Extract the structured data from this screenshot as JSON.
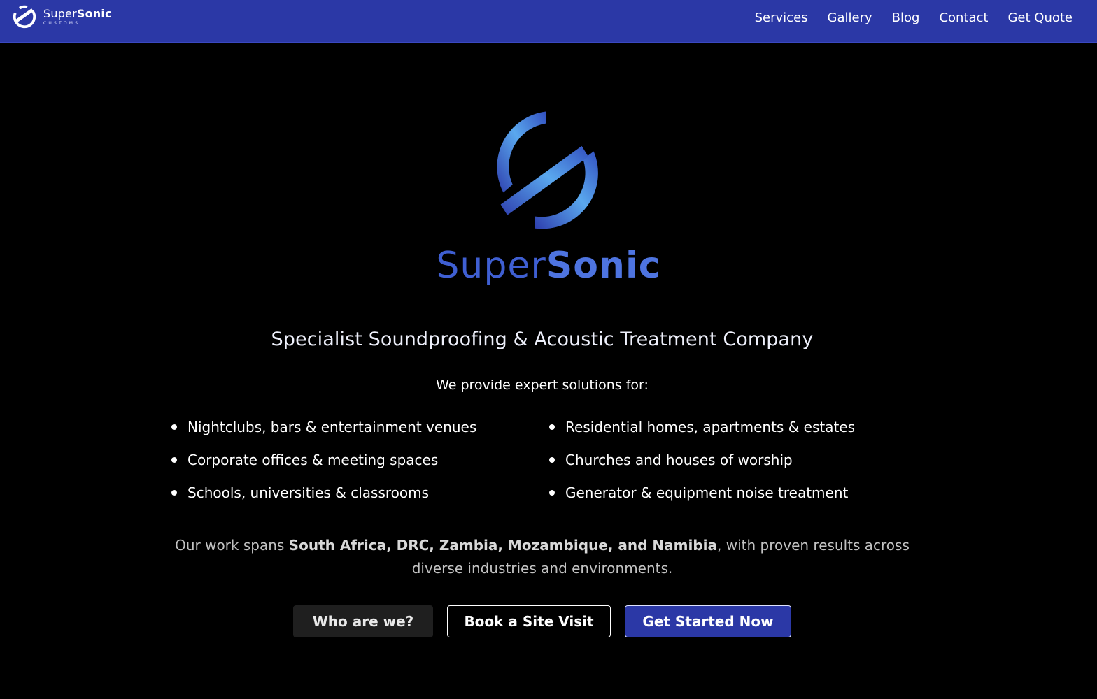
{
  "brand": {
    "name_light": "Super",
    "name_bold": "Sonic",
    "tagline": "CUSTOMS",
    "logo_icon": "supersonic-s-logo-icon"
  },
  "nav": {
    "items": [
      {
        "label": "Services"
      },
      {
        "label": "Gallery"
      },
      {
        "label": "Blog"
      },
      {
        "label": "Contact"
      },
      {
        "label": "Get Quote"
      }
    ]
  },
  "hero": {
    "logo_icon": "supersonic-s-logo-icon",
    "wordmark_light": "Super",
    "wordmark_bold": "Sonic",
    "tagline": "Specialist Soundproofing & Acoustic Treatment Company",
    "intro": "We provide expert solutions for:",
    "services": [
      "Nightclubs, bars & entertainment venues",
      "Residential homes, apartments & estates",
      "Corporate offices & meeting spaces",
      "Churches and houses of worship",
      "Schools, universities & classrooms",
      "Generator & equipment noise treatment"
    ],
    "reach_prefix": "Our work spans ",
    "reach_countries": "South Africa, DRC, Zambia, Mozambique, and Namibia",
    "reach_suffix": ", with proven results across diverse industries and environments."
  },
  "buttons": {
    "who": "Who are we?",
    "visit": "Book a Site Visit",
    "start": "Get Started Now"
  },
  "colors": {
    "nav_bg": "#2b38a6",
    "page_bg": "#000000",
    "logo_gradient_light": "#5aa8ee",
    "logo_gradient_dark": "#2e3fae"
  }
}
